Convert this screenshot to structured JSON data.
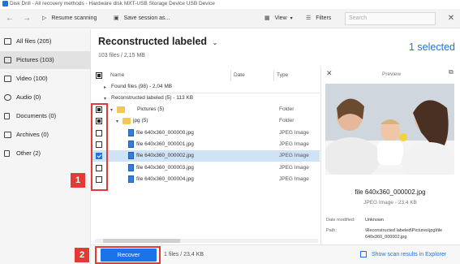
{
  "window": {
    "title": "Disk Drill - All recovery methods - Hardware disk MXT-USB Storage Device USB Device"
  },
  "toolbar": {
    "back_icon": "arrow-left-icon",
    "forward_icon": "arrow-right-icon",
    "resume_label": "Resume scanning",
    "save_session_label": "Save session as...",
    "view_label": "View",
    "filters_label": "Filters",
    "search_placeholder": "Search",
    "close_icon": "close-icon"
  },
  "sidebar": {
    "items": [
      {
        "label": "All files (205)",
        "icon": "files-icon",
        "active": false
      },
      {
        "label": "Pictures (103)",
        "icon": "image-icon",
        "active": true
      },
      {
        "label": "Video (100)",
        "icon": "video-icon",
        "active": false
      },
      {
        "label": "Audio (0)",
        "icon": "music-icon",
        "active": false
      },
      {
        "label": "Documents (0)",
        "icon": "document-icon",
        "active": false
      },
      {
        "label": "Archives (0)",
        "icon": "archive-icon",
        "active": false
      },
      {
        "label": "Other (2)",
        "icon": "other-icon",
        "active": false
      }
    ]
  },
  "content": {
    "title": "Reconstructed labeled",
    "subtitle": "103 files / 2,15 MB",
    "selected_label": "1 selected"
  },
  "table": {
    "columns": [
      "Name",
      "Date",
      "Type"
    ],
    "groups": [
      {
        "label": "Found files (98) - 2,04 MB"
      },
      {
        "label": "Reconstructed labeled (5) - 113 KB"
      }
    ],
    "rows": [
      {
        "name": "Pictures (5)",
        "type": "Folder",
        "kind": "folder",
        "check": "partial",
        "selected": false
      },
      {
        "name": "jpg (5)",
        "type": "Folder",
        "kind": "folder",
        "check": "partial",
        "selected": false
      },
      {
        "name": "file 640x360_000000.jpg",
        "type": "JPEG Image",
        "kind": "image",
        "check": "none",
        "selected": false
      },
      {
        "name": "file 640x360_000001.jpg",
        "type": "JPEG Image",
        "kind": "image",
        "check": "none",
        "selected": false
      },
      {
        "name": "file 640x360_000002.jpg",
        "type": "JPEG Image",
        "kind": "image",
        "check": "checked",
        "selected": true
      },
      {
        "name": "file 640x360_000003.jpg",
        "type": "JPEG Image",
        "kind": "image",
        "check": "none",
        "selected": false
      },
      {
        "name": "file 640x360_000004.jpg",
        "type": "JPEG Image",
        "kind": "image",
        "check": "none",
        "selected": false
      }
    ]
  },
  "annotations": {
    "badge1": "1",
    "badge2": "2",
    "color": "#e53935"
  },
  "preview": {
    "title": "Preview",
    "file_name": "file 640x360_000002.jpg",
    "file_meta": "JPEG Image - 23,4 KB",
    "date_modified_label": "Date modified:",
    "date_modified_value": "Unknown",
    "path_label": "Path:",
    "path_value_line1": "\\Reconstructed labeled\\Pictures\\jpg\\file",
    "path_value_line2": "640x360_000002.jpg"
  },
  "bottom": {
    "recover_label": "Recover",
    "info": "1 files / 23,4 KB",
    "scan_link": "Show scan results in Explorer"
  },
  "colors": {
    "accent": "#1a73e8",
    "selected_row": "#cfe3f7",
    "folder": "#f2c94c"
  }
}
